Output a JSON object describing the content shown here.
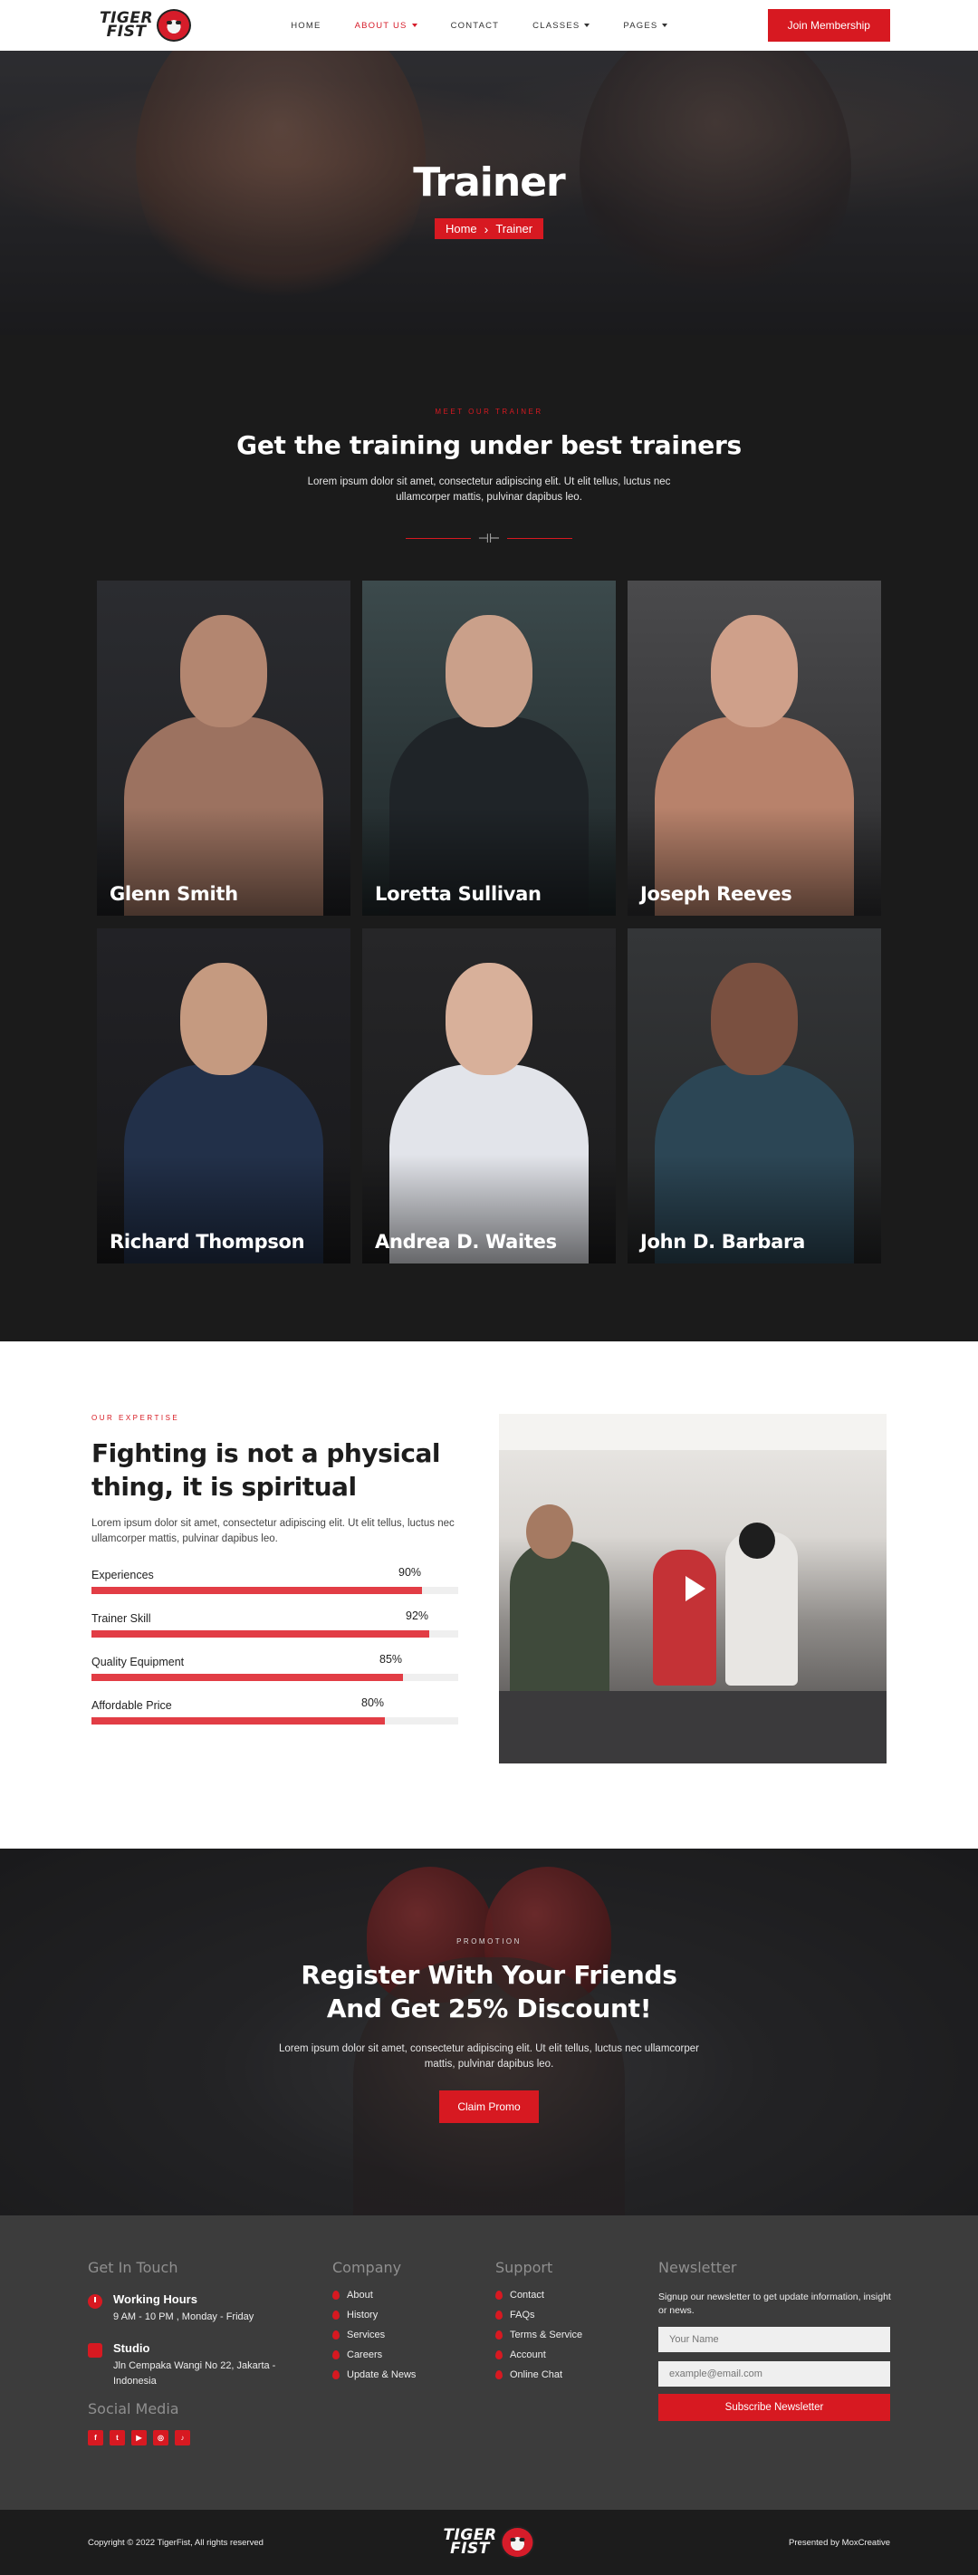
{
  "brand": {
    "line1": "TIGER",
    "line2": "FIST"
  },
  "nav": {
    "items": [
      {
        "label": "HOME",
        "caret": false,
        "active": false
      },
      {
        "label": "ABOUT US",
        "caret": true,
        "active": true
      },
      {
        "label": "CONTACT",
        "caret": false,
        "active": false
      },
      {
        "label": "CLASSES",
        "caret": true,
        "active": false
      },
      {
        "label": "PAGES",
        "caret": true,
        "active": false
      }
    ],
    "cta": "Join Membership"
  },
  "hero": {
    "title": "Trainer",
    "breadcrumb_home": "Home",
    "breadcrumb_current": "Trainer"
  },
  "trainers": {
    "eyebrow": "MEET OUR TRAINER",
    "heading": "Get the training under best trainers",
    "lead": "Lorem ipsum dolor sit amet, consectetur adipiscing elit. Ut elit tellus, luctus nec ullamcorper mattis, pulvinar dapibus leo.",
    "items": [
      {
        "name": "Glenn Smith"
      },
      {
        "name": "Loretta Sullivan"
      },
      {
        "name": "Joseph Reeves"
      },
      {
        "name": "Richard Thompson"
      },
      {
        "name": "Andrea D. Waites"
      },
      {
        "name": "John D. Barbara"
      }
    ]
  },
  "expertise": {
    "eyebrow": "OUR EXPERTISE",
    "heading": "Fighting is not a physical thing, it is spiritual",
    "desc": "Lorem ipsum dolor sit amet, consectetur adipiscing elit. Ut elit tellus, luctus nec ullamcorper mattis, pulvinar dapibus leo.",
    "skills": [
      {
        "label": "Experiences",
        "value": 90,
        "display": "90%"
      },
      {
        "label": "Trainer Skill",
        "value": 92,
        "display": "92%"
      },
      {
        "label": "Quality Equipment",
        "value": 85,
        "display": "85%"
      },
      {
        "label": "Affordable Price",
        "value": 80,
        "display": "80%"
      }
    ]
  },
  "promo": {
    "eyebrow": "PROMOTION",
    "heading": "Register With Your Friends And Get 25% Discount!",
    "desc": "Lorem ipsum dolor sit amet, consectetur adipiscing elit. Ut elit tellus, luctus nec ullamcorper mattis, pulvinar dapibus leo.",
    "button": "Claim Promo"
  },
  "footer": {
    "contact": {
      "heading": "Get In Touch",
      "hours_title": "Working Hours",
      "hours": "9 AM - 10 PM , Monday - Friday",
      "studio_title": "Studio",
      "studio": "Jln Cempaka Wangi No 22, Jakarta - Indonesia"
    },
    "social_heading": "Social Media",
    "socials": [
      "f",
      "t",
      "▶",
      "◎",
      "♪"
    ],
    "company": {
      "heading": "Company",
      "links": [
        "About",
        "History",
        "Services",
        "Careers",
        "Update & News"
      ]
    },
    "support": {
      "heading": "Support",
      "links": [
        "Contact",
        "FAQs",
        "Terms & Service",
        "Account",
        "Online Chat"
      ]
    },
    "newsletter": {
      "heading": "Newsletter",
      "text": "Signup our newsletter to get update information, insight or news.",
      "name_placeholder": "Your Name",
      "email_placeholder": "example@email.com",
      "button": "Subscribe Newsletter"
    },
    "copyright": "Copyright © 2022 TigerFist, All rights reserved",
    "presented": "Presented by MoxCreative"
  },
  "colors": {
    "accent": "#d71921",
    "dark": "#1b1b1b",
    "footer": "#3c3c3c"
  }
}
